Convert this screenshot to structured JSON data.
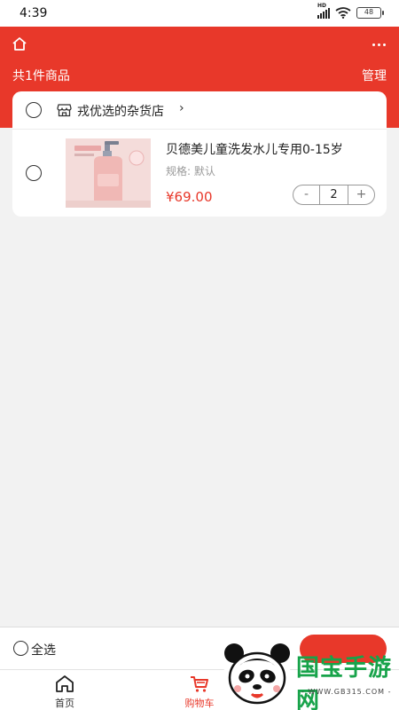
{
  "status_bar": {
    "time": "4:39",
    "battery": "48",
    "network": "HD"
  },
  "header": {
    "count_text": "共1件商品",
    "manage_label": "管理"
  },
  "shop": {
    "name": "戎优选的杂货店",
    "chevron": "›"
  },
  "product": {
    "title": "贝德美儿童洗发水儿专用0-15岁",
    "spec": "规格:  默认",
    "price": "¥69.00",
    "quantity": "2",
    "minus": "-",
    "plus": "+"
  },
  "footer": {
    "select_all_label": "全选"
  },
  "tabbar": {
    "home_label": "首页",
    "cart_label": "购物车"
  },
  "watermark": {
    "text": "国宝手游网",
    "url": "- WWW.GB315.COM -"
  },
  "colors": {
    "accent": "#e8382a",
    "background": "#f2f2f2",
    "watermark": "#17a34a"
  }
}
